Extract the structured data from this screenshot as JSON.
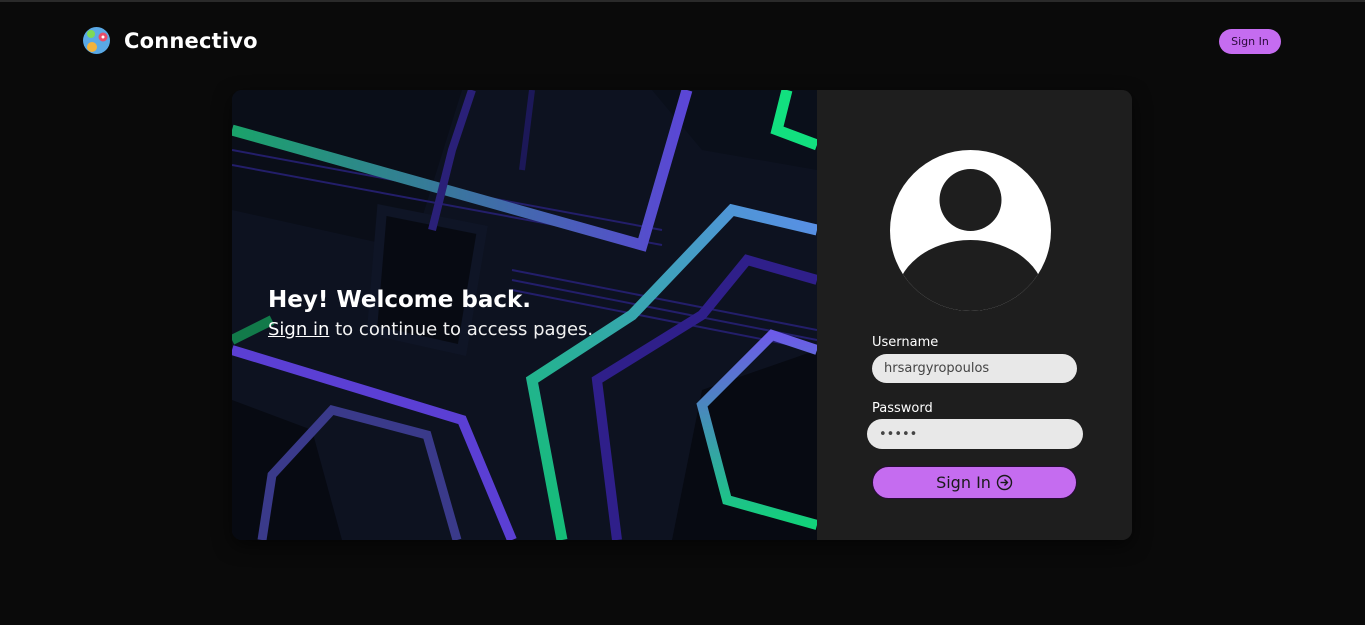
{
  "brand": {
    "name": "Connectivo",
    "logo_icon": "connectivo-logo-icon"
  },
  "nav": {
    "signin_label": "Sign In"
  },
  "welcome": {
    "title": "Hey! Welcome back.",
    "link_text": "Sign in",
    "rest_text": " to continue to access pages."
  },
  "form": {
    "avatar_icon": "user-avatar-icon",
    "username_label": "Username",
    "username_value": "hrsargyropoulos",
    "password_label": "Password",
    "password_value": "•••••",
    "submit_label": "Sign In",
    "submit_icon": "sign-in-arrow-icon"
  },
  "colors": {
    "background": "#0a0a0a",
    "card_panel": "#1e1e1e",
    "accent": "#c56cf0",
    "input_bg": "#e8e8e8"
  }
}
